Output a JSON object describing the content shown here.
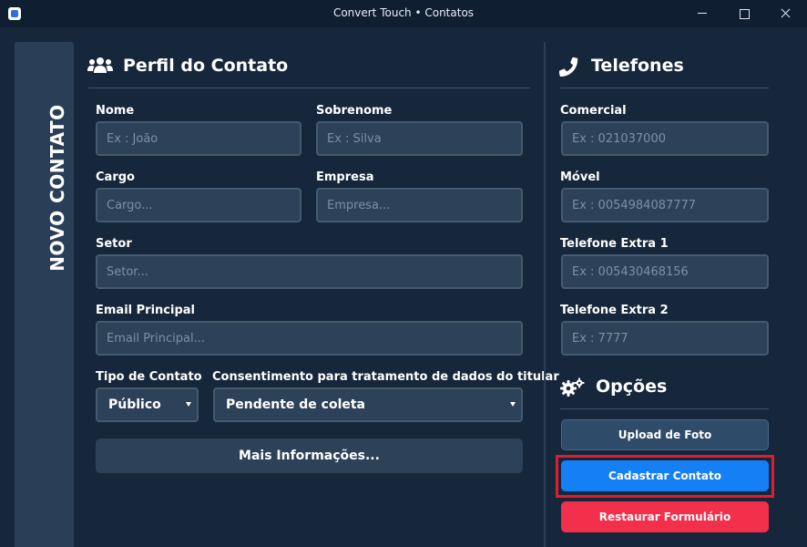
{
  "window": {
    "title": "Convert Touch • Contatos"
  },
  "sidebar": {
    "label": "NOVO CONTATO"
  },
  "profile": {
    "title": "Perfil do Contato",
    "icon": "users-icon",
    "fields": {
      "nome": {
        "label": "Nome",
        "placeholder": "Ex : João"
      },
      "sobrenome": {
        "label": "Sobrenome",
        "placeholder": "Ex : Silva"
      },
      "cargo": {
        "label": "Cargo",
        "placeholder": "Cargo..."
      },
      "empresa": {
        "label": "Empresa",
        "placeholder": "Empresa..."
      },
      "setor": {
        "label": "Setor",
        "placeholder": "Setor..."
      },
      "email": {
        "label": "Email Principal",
        "placeholder": "Email Principal..."
      }
    },
    "tipo_contato": {
      "label": "Tipo de Contato",
      "value": "Público"
    },
    "consentimento": {
      "label": "Consentimento para tratamento de dados do titular",
      "value": "Pendente de coleta"
    },
    "more_button": "Mais Informações..."
  },
  "phones": {
    "title": "Telefones",
    "icon": "phone-icon",
    "fields": {
      "comercial": {
        "label": "Comercial",
        "placeholder": "Ex : 021037000"
      },
      "movel": {
        "label": "Móvel",
        "placeholder": "Ex : 0054984087777"
      },
      "extra1": {
        "label": "Telefone Extra 1",
        "placeholder": "Ex : 005430468156"
      },
      "extra2": {
        "label": "Telefone Extra 2",
        "placeholder": "Ex : 7777"
      }
    }
  },
  "options": {
    "title": "Opções",
    "icon": "gears-icon",
    "upload": "Upload de Foto",
    "cadastrar": "Cadastrar Contato",
    "restaurar": "Restaurar Formulário"
  },
  "colors": {
    "background": "#16273c",
    "panel": "#2d4158",
    "primary": "#1580f5",
    "danger": "#f2304b",
    "highlight": "#e21c2e"
  }
}
